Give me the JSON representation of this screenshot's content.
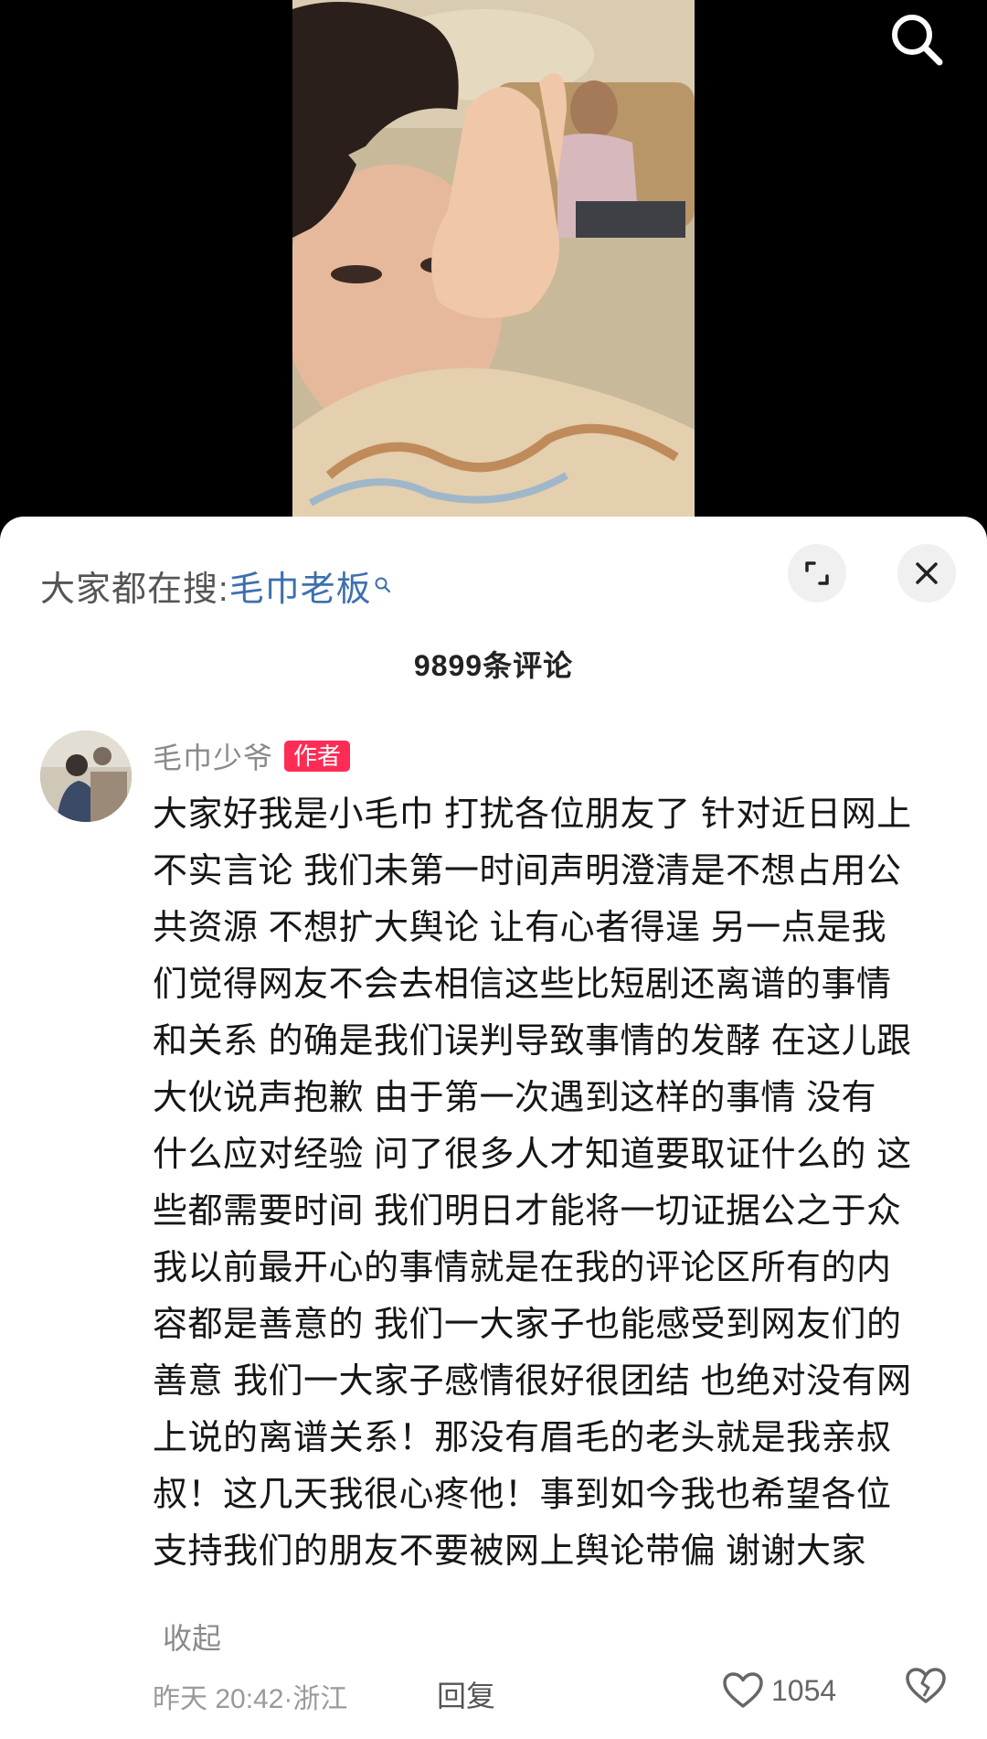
{
  "top_bar": {
    "search_icon": "search-icon"
  },
  "sheet": {
    "search_prefix": "大家都在搜:",
    "search_term": "毛巾老板",
    "comment_count": "9899条评论",
    "expand_icon": "expand-icon",
    "close_icon": "close-icon"
  },
  "comment": {
    "author": "毛巾少爷",
    "author_tag": "作者",
    "lines": [
      "大家好我是小毛巾 打扰各位朋友了 针对近日网上",
      "不实言论 我们未第一时间声明澄清是不想占用公",
      "共资源 不想扩大舆论 让有心者得逞 另一点是我",
      "们觉得网友不会去相信这些比短剧还离谱的事情",
      "和关系 的确是我们误判导致事情的发酵 在这儿跟",
      "大伙说声抱歉  由于第一次遇到这样的事情 没有",
      "什么应对经验 问了很多人才知道要取证什么的 这",
      "些都需要时间 我们明日才能将一切证据公之于众",
      "我以前最开心的事情就是在我的评论区所有的内",
      "容都是善意的 我们一大家子也能感受到网友们的",
      "善意 我们一大家子感情很好很团结 也绝对没有网",
      "上说的离谱关系！那没有眉毛的老头就是我亲叔",
      "叔！这几天我很心疼他！事到如今我也希望各位",
      "支持我们的朋友不要被网上舆论带偏 谢谢大家"
    ],
    "collapse_label": "收起",
    "time": "昨天 20:42",
    "location": "浙江",
    "reply_label": "回复",
    "like_count": "1054"
  },
  "colors": {
    "accent_link": "#3d6fb0",
    "author_tag_bg": "#fe2c55"
  }
}
